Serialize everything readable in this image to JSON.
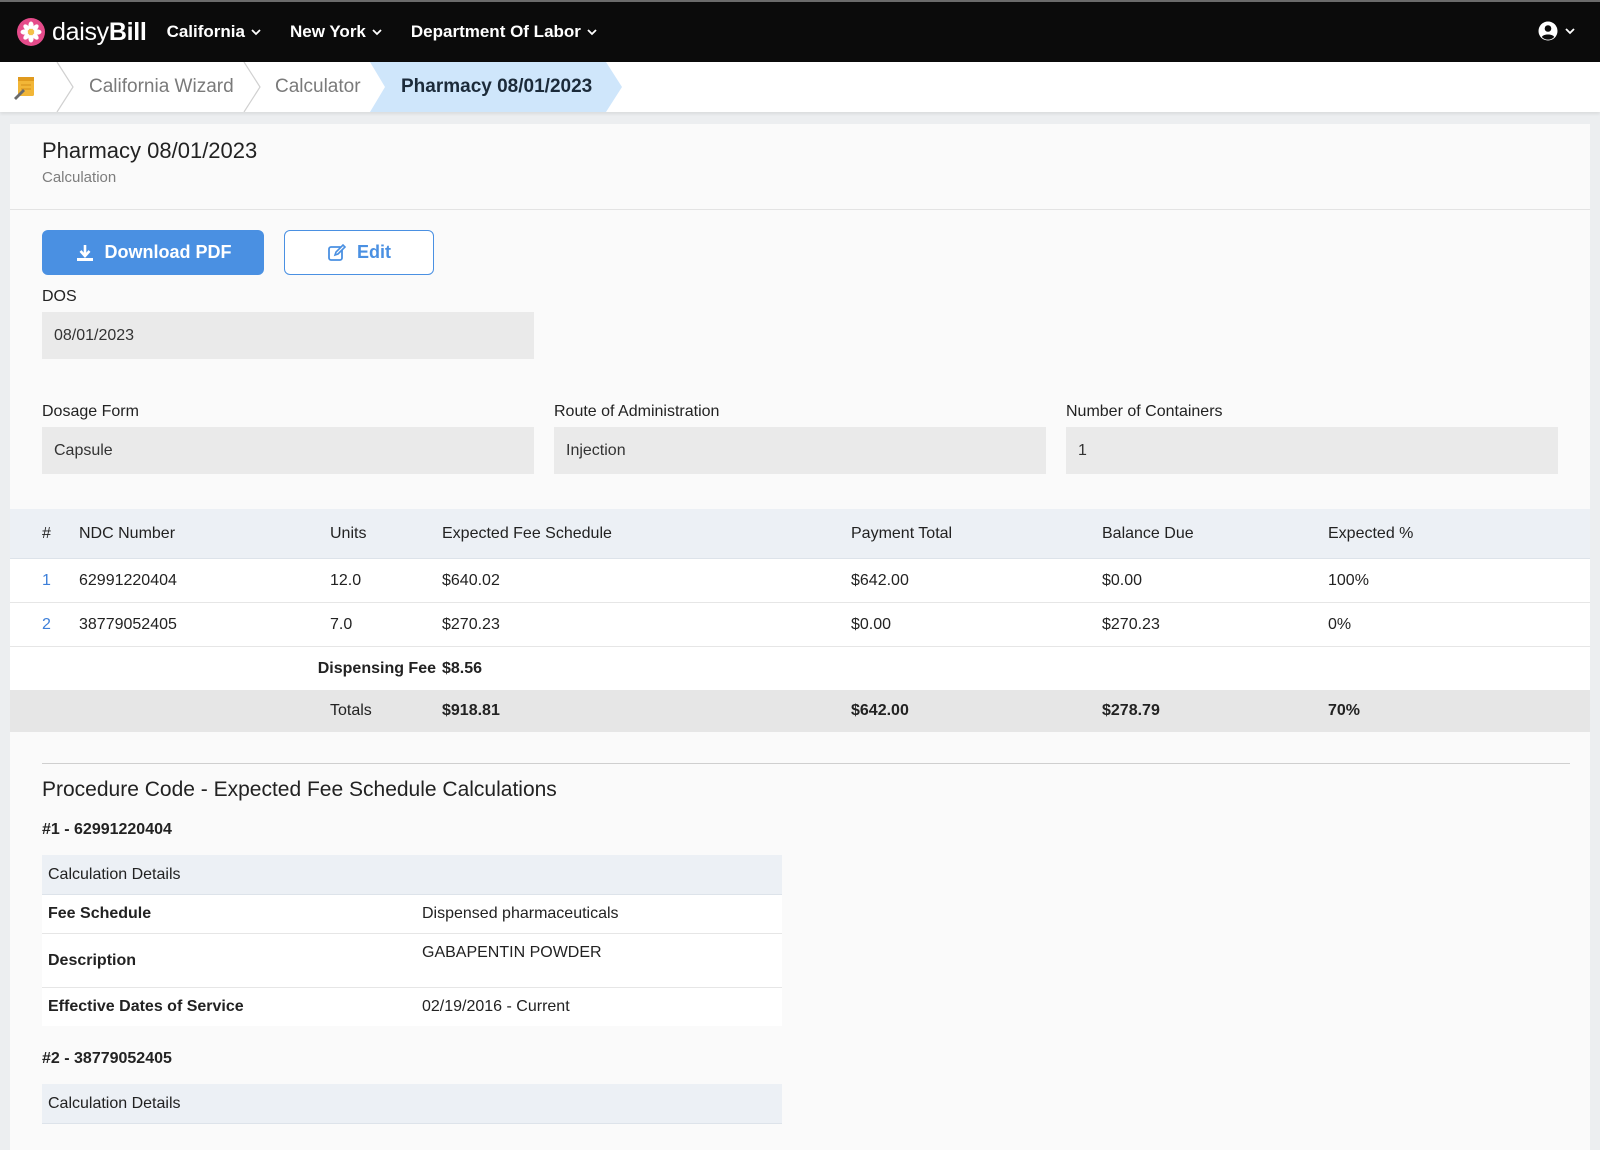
{
  "nav": {
    "brand_daisy": "daisy",
    "brand_bill": "Bill",
    "links": [
      "California",
      "New York",
      "Department Of Labor"
    ]
  },
  "breadcrumb": {
    "items": [
      "California Wizard",
      "Calculator",
      "Pharmacy 08/01/2023"
    ]
  },
  "header": {
    "title": "Pharmacy 08/01/2023",
    "subtitle": "Calculation"
  },
  "actions": {
    "download_label": "Download PDF",
    "edit_label": "Edit"
  },
  "form": {
    "dos_label": "DOS",
    "dos_value": "08/01/2023",
    "dosage_form_label": "Dosage Form",
    "dosage_form_value": "Capsule",
    "route_label": "Route of Administration",
    "route_value": "Injection",
    "containers_label": "Number of Containers",
    "containers_value": "1"
  },
  "table": {
    "headers": [
      "#",
      "NDC Number",
      "Units",
      "Expected Fee Schedule",
      "Payment Total",
      "Balance Due",
      "Expected %"
    ],
    "rows": [
      [
        "1",
        "62991220404",
        "12.0",
        "$640.02",
        "$642.00",
        "$0.00",
        "100%"
      ],
      [
        "2",
        "38779052405",
        "7.0",
        "$270.23",
        "$0.00",
        "$270.23",
        "0%"
      ]
    ],
    "dispensing_fee_label": "Dispensing Fee",
    "dispensing_fee_value": "$8.56",
    "totals": {
      "label": "Totals",
      "expected_fee": "$918.81",
      "payment_total": "$642.00",
      "balance_due": "$278.79",
      "expected_pct": "70%"
    }
  },
  "procedures": {
    "section_title": "Procedure Code - Expected Fee Schedule Calculations",
    "items": [
      {
        "title": "#1 - 62991220404",
        "details_header": "Calculation Details",
        "rows": [
          [
            "Fee Schedule",
            "Dispensed pharmaceuticals"
          ],
          [
            "Description",
            "GABAPENTIN POWDER"
          ],
          [
            "Effective Dates of Service",
            "02/19/2016 - Current"
          ]
        ]
      },
      {
        "title": "#2 - 38779052405",
        "details_header": "Calculation Details"
      }
    ]
  },
  "colors": {
    "nav_bg": "#0b0b0b",
    "accent": "#4a90e2",
    "active_crumb_bg": "#cfe6fb"
  }
}
